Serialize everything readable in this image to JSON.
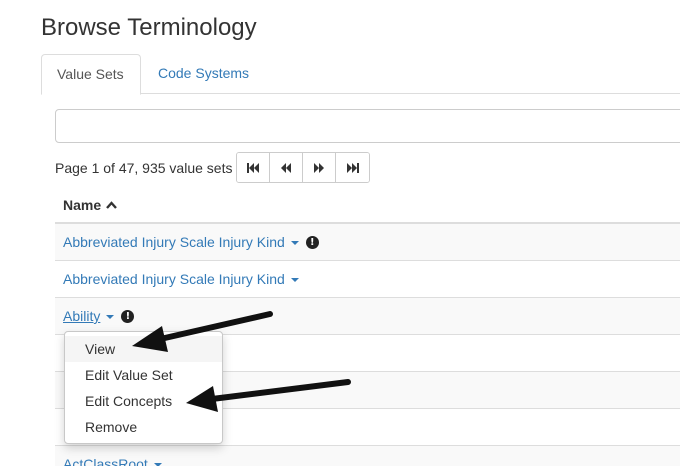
{
  "page": {
    "title": "Browse Terminology"
  },
  "tabs": [
    {
      "label": "Value Sets",
      "active": true
    },
    {
      "label": "Code Systems",
      "active": false
    }
  ],
  "search": {
    "value": "",
    "placeholder": ""
  },
  "pager": {
    "text": "Page 1 of 47, 935 value sets",
    "buttons": [
      "first-page-icon",
      "previous-page-icon",
      "next-page-icon",
      "last-page-icon"
    ]
  },
  "table": {
    "header": "Name",
    "sort_icon": "chevron-up-icon",
    "rows": [
      {
        "name": "Abbreviated Injury Scale Injury Kind",
        "warning": true
      },
      {
        "name": "Abbreviated Injury Scale Injury Kind",
        "warning": false
      },
      {
        "name": "Ability",
        "warning": true
      },
      {
        "name": "",
        "warning": false
      },
      {
        "name": "",
        "warning": false
      },
      {
        "name": "",
        "warning": false
      },
      {
        "name": "ActClassRoot",
        "warning": false
      }
    ]
  },
  "dropdown": {
    "items": [
      "View",
      "Edit Value Set",
      "Edit Concepts",
      "Remove"
    ]
  },
  "colors": {
    "link": "#337ab7",
    "border": "#dddddd",
    "stripe": "#f9f9f9",
    "arrow": "#111111"
  }
}
